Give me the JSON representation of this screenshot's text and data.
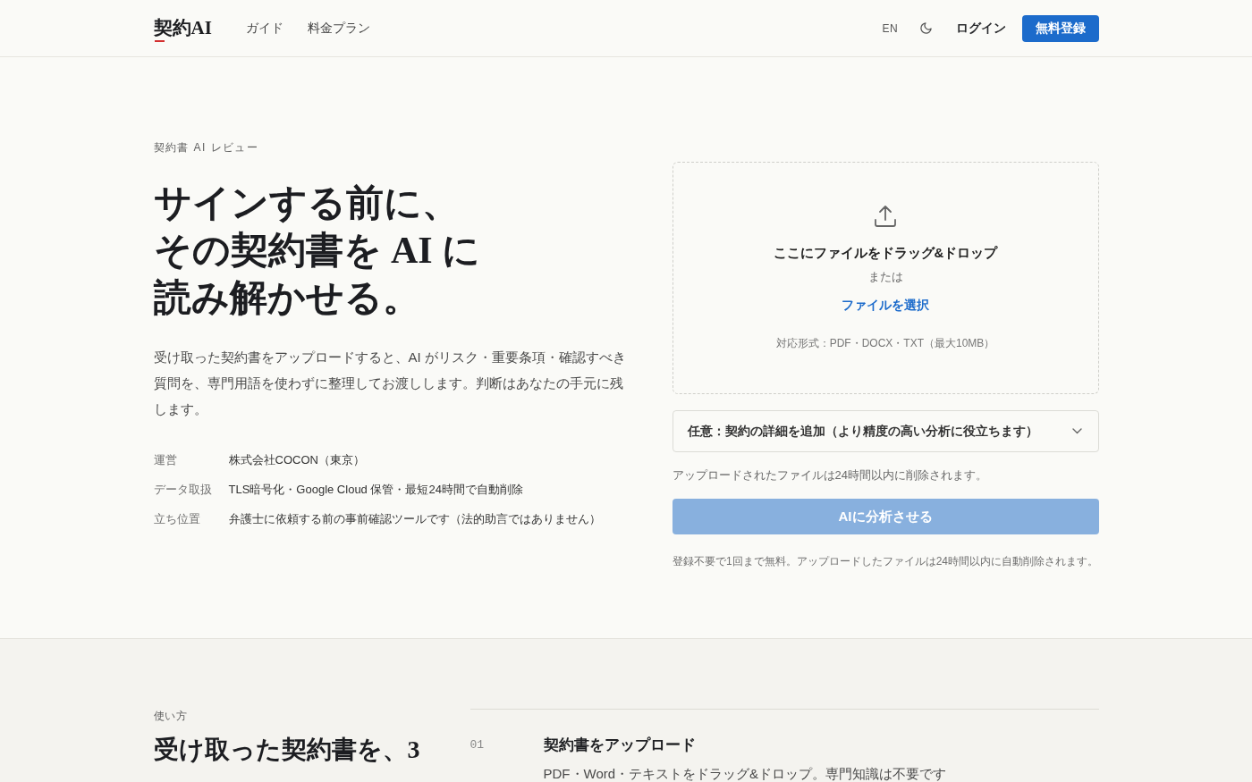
{
  "header": {
    "logo": "契約AI",
    "nav": [
      "ガイド",
      "料金プラン"
    ],
    "language": "EN",
    "login": "ログイン",
    "signup": "無料登録"
  },
  "hero": {
    "eyebrow": "契約書 AI レビュー",
    "headline": [
      "サインする前に、",
      "その契約書を AI に",
      "読み解かせる。"
    ],
    "lead": "受け取った契約書をアップロードすると、AI がリスク・重要条項・確認すべき質問を、専門用語を使わずに整理してお渡しします。判断はあなたの手元に残します。",
    "facts": [
      {
        "label": "運営",
        "value": "株式会社COCON（東京）"
      },
      {
        "label": "データ取扱",
        "value": "TLS暗号化・Google Cloud 保管・最短24時間で自動削除"
      },
      {
        "label": "立ち位置",
        "value": "弁護士に依頼する前の事前確認ツールです（法的助言ではありません）"
      }
    ]
  },
  "upload": {
    "dropzone": {
      "title": "ここにファイルをドラッグ&ドロップ",
      "separator": "または",
      "select_link": "ファイルを選択",
      "formats": "対応形式：PDF・DOCX・TXT（最大10MB）"
    },
    "details": {
      "summary": "任意：契約の詳細を追加（より精度の高い分析に役立ちます）",
      "expanded": false
    },
    "retention_note": "アップロードされたファイルは24時間以内に削除されます。",
    "submit": {
      "label": "AIに分析させる",
      "disabled": true
    },
    "footnote": "登録不要で1回まで無料。アップロードしたファイルは24時間以内に自動削除されます。"
  },
  "how_it_works": {
    "eyebrow": "使い方",
    "heading": "受け取った契約書を、3",
    "steps": [
      {
        "number": "01",
        "title": "契約書をアップロード",
        "description": "PDF・Word・テキストをドラッグ&ドロップ。専門知識は不要です"
      }
    ]
  }
}
